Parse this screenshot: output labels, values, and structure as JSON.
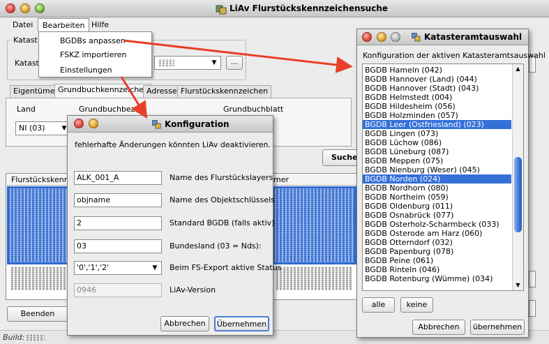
{
  "app": {
    "title": "LiAv Flurstückskennzeichensuche"
  },
  "menu": {
    "file": "Datei",
    "edit": "Bearbeiten",
    "help": "Hilfe"
  },
  "edit_menu": {
    "items": [
      "BGDBs anpassen",
      "FSKZ importieren",
      "Einstellungen"
    ]
  },
  "main": {
    "group_title": "Katast",
    "katasteramt_label": "Kataste",
    "browse_button": "...",
    "tabs": [
      "Eigentümer",
      "Grundbuchkennzeichen",
      "Adresse",
      "Flurstückskennzeichen"
    ],
    "land_label": "Land",
    "land_value": "NI (03)",
    "grundbuchbezirk_label": "Grundbuchbezirk",
    "grundbuchblatt_label": "Grundbuchblatt",
    "search_button": "Suche",
    "grid_col1": "Flurstückskennz",
    "grid_col2": "mer",
    "quit_button": "Beenden"
  },
  "status": {
    "build_label": "Build:"
  },
  "config": {
    "title": "Konfiguration",
    "warning": "fehlerhafte Änderungen könnten LiAv deaktivieren.",
    "fields": [
      {
        "value": "ALK_001_A",
        "label": "Name des Flurstückslayers"
      },
      {
        "value": "objname",
        "label": "Name des Objektschlüssels"
      },
      {
        "value": "2",
        "label": "Standard BGDB (falls aktiv)"
      },
      {
        "value": "03",
        "label": "Bundesland (03 = Nds):"
      },
      {
        "value": "'0','1','2'",
        "label": "Beim FS-Export aktive Status"
      },
      {
        "value": "0946",
        "label": "LiAv-Version"
      }
    ],
    "cancel": "Abbrechen",
    "apply": "Übernehmen"
  },
  "kataster": {
    "title": "Katasteramtauswahl",
    "caption": "Konfiguration der aktiven Katasteramtsauswahl",
    "items": [
      "BGDB Hameln (042)",
      "BGDB Hannover (Land) (044)",
      "BGDB Hannover (Stadt) (043)",
      "BGDB Helmstedt (004)",
      "BGDB Hildesheim (056)",
      "BGDB Holzminden (057)",
      "BGDB Leer (Ostfriesland) (023)",
      "BGDB Lingen (073)",
      "BGDB Lüchow (086)",
      "BGDB Lüneburg (087)",
      "BGDB Meppen (075)",
      "BGDB Nienburg (Weser) (045)",
      "BGDB Norden (024)",
      "BGDB Nordhorn (080)",
      "BGDB Northeim (059)",
      "BGDB Oldenburg (011)",
      "BGDB Osnabrück (077)",
      "BGDB Osterholz-Scharmbeck (033)",
      "BGDB Osterode am Harz (060)",
      "BGDB Otterndorf (032)",
      "BGDB Papenburg (078)",
      "BGDB Peine (061)",
      "BGDB Rinteln (046)",
      "BGDB Rotenburg (Wümme) (034)"
    ],
    "selected": [
      "BGDB Leer (Ostfriesland) (023)",
      "BGDB Norden (024)"
    ],
    "all_button": "alle",
    "none_button": "keine",
    "cancel": "Abbrechen",
    "apply": "übernehmen"
  },
  "colors": {
    "selection": "#3470d8",
    "arrow": "#e8402a"
  }
}
